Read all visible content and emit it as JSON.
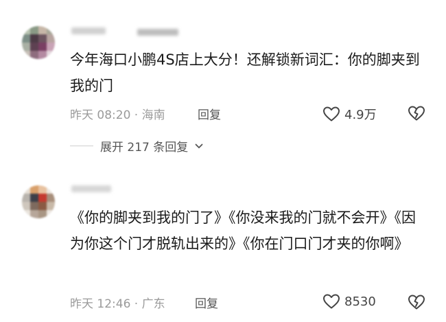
{
  "comments": [
    {
      "text": "今年海口小鹏4S店上大分！还解锁新词汇：你的脚夹到我的门",
      "time_location": "昨天 08:20 · 海南",
      "reply_label": "回复",
      "likes": "4.9万",
      "expand_label": "展开 217 条回复"
    },
    {
      "text": "《你的脚夹到我的门了》《你没来我的门就不会开》《因为你这个门才脱轨出来的》《你在门口门才夹的你啊》",
      "time_location": "昨天 12:46 · 广东",
      "reply_label": "回复",
      "likes": "8530"
    }
  ],
  "icons": {
    "like": "heart-outline-icon",
    "dislike": "broken-heart-icon",
    "expand": "chevron-down-icon"
  },
  "colors": {
    "text": "#1a1a1a",
    "meta": "#9a9a9a",
    "icon": "#444444"
  }
}
